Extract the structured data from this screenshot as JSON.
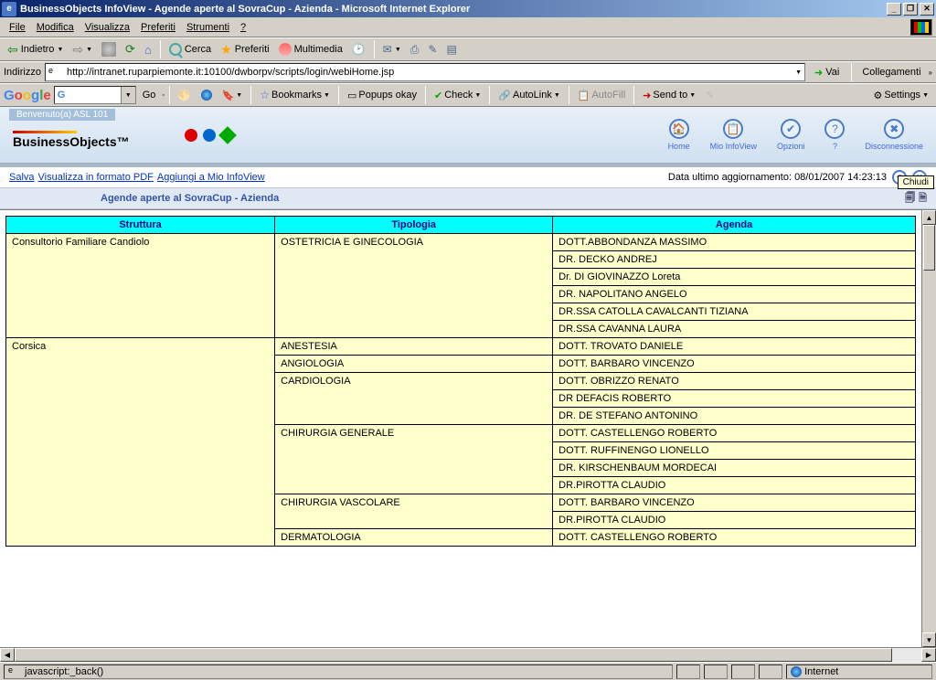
{
  "title": "BusinessObjects InfoView - Agende aperte al SovraCup - Azienda - Microsoft Internet Explorer",
  "menu": [
    "File",
    "Modifica",
    "Visualizza",
    "Preferiti",
    "Strumenti",
    "?"
  ],
  "toolbar": {
    "back": "Indietro",
    "search": "Cerca",
    "fav": "Preferiti",
    "media": "Multimedia"
  },
  "addr": {
    "label": "Indirizzo",
    "url": "http://intranet.ruparpiemonte.it:10100/dwborpv/scripts/login/webiHome.jsp",
    "go": "Vai",
    "coll": "Collegamenti"
  },
  "google": {
    "go": "Go",
    "bookmarks": "Bookmarks",
    "popups": "Popups okay",
    "check": "Check",
    "autolink": "AutoLink",
    "autofill": "AutoFill",
    "send": "Send to",
    "settings": "Settings"
  },
  "bo": {
    "welcome": "Benvenuto(a) ASL 101",
    "logo1": "Business",
    "logo2": "Objects",
    "nav": {
      "home": "Home",
      "info": "Mio InfoView",
      "opz": "Opzioni",
      "help": "?",
      "disc": "Disconnessione"
    }
  },
  "links": {
    "salva": "Salva",
    "pdf": "Visualizza in formato PDF",
    "add": "Aggiungi a Mio InfoView",
    "tslabel": "Data ultimo aggiornamento: 08/01/2007 14:23:13"
  },
  "chiudi": "Chiudi",
  "reportTitle": "Agende aperte al SovraCup - Azienda",
  "table": {
    "headers": [
      "Struttura",
      "Tipologia",
      "Agenda"
    ],
    "rows": [
      [
        "Consultorio Familiare Candiolo",
        "OSTETRICIA E GINECOLOGIA",
        "DOTT.ABBONDANZA MASSIMO"
      ],
      [
        "",
        "",
        "DR. DECKO ANDREJ"
      ],
      [
        "",
        "",
        "Dr. DI GIOVINAZZO Loreta"
      ],
      [
        "",
        "",
        "DR. NAPOLITANO ANGELO"
      ],
      [
        "",
        "",
        "DR.SSA CATOLLA CAVALCANTI TIZIANA"
      ],
      [
        "",
        "",
        "DR.SSA CAVANNA LAURA"
      ],
      [
        "Corsica",
        "ANESTESIA",
        "DOTT. TROVATO DANIELE"
      ],
      [
        "",
        "ANGIOLOGIA",
        "DOTT. BARBARO VINCENZO"
      ],
      [
        "",
        "CARDIOLOGIA",
        "DOTT. OBRIZZO RENATO"
      ],
      [
        "",
        "",
        "DR DEFACIS ROBERTO"
      ],
      [
        "",
        "",
        "DR. DE STEFANO ANTONINO"
      ],
      [
        "",
        "CHIRURGIA GENERALE",
        "DOTT. CASTELLENGO ROBERTO"
      ],
      [
        "",
        "",
        "DOTT. RUFFINENGO LIONELLO"
      ],
      [
        "",
        "",
        "DR. KIRSCHENBAUM MORDECAI"
      ],
      [
        "",
        "",
        "DR.PIROTTA CLAUDIO"
      ],
      [
        "",
        "CHIRURGIA VASCOLARE",
        "DOTT. BARBARO VINCENZO"
      ],
      [
        "",
        "",
        "DR.PIROTTA CLAUDIO"
      ],
      [
        "",
        "DERMATOLOGIA",
        "DOTT. CASTELLENGO ROBERTO"
      ]
    ]
  },
  "status": {
    "left": "javascript:_back()",
    "zone": "Internet"
  }
}
